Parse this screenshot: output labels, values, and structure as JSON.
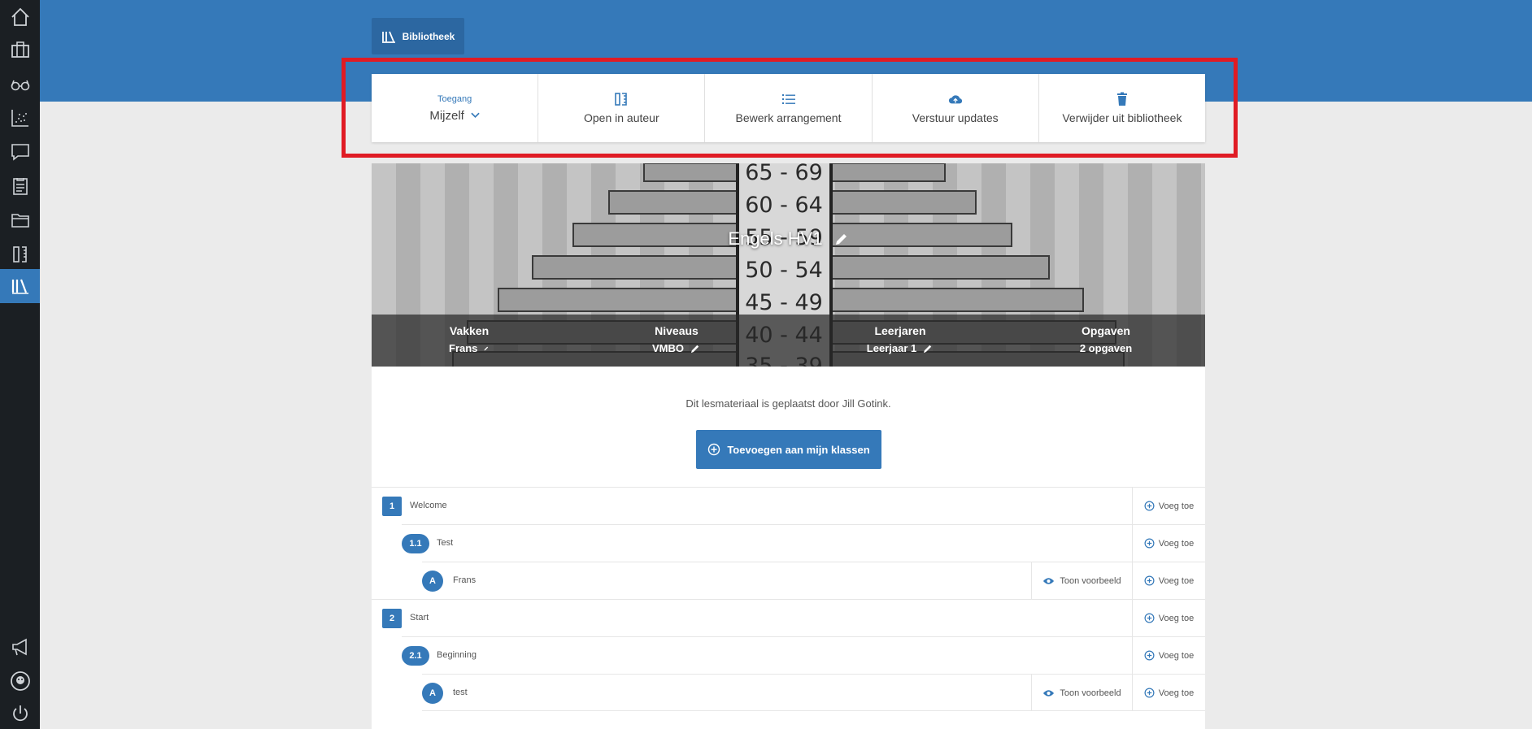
{
  "sidebar": {
    "items": [
      {
        "icon": "home-icon"
      },
      {
        "icon": "briefcase-icon"
      },
      {
        "icon": "glasses-icon"
      },
      {
        "icon": "chart-icon"
      },
      {
        "icon": "chat-icon"
      },
      {
        "icon": "clipboard-icon"
      },
      {
        "icon": "folder-icon"
      },
      {
        "icon": "author-icon"
      },
      {
        "icon": "library-icon",
        "active": true
      }
    ],
    "bottom": [
      {
        "icon": "megaphone-icon"
      },
      {
        "icon": "avatar-icon"
      },
      {
        "icon": "power-icon"
      }
    ]
  },
  "header": {
    "tab_label": "Bibliotheek"
  },
  "actions": {
    "access_label": "Toegang",
    "access_value": "Mijzelf",
    "open_author": "Open in auteur",
    "edit_arrangement": "Bewerk arrangement",
    "send_updates": "Verstuur updates",
    "remove_library": "Verwijder uit bibliotheek"
  },
  "hero": {
    "title": "Engels HV1",
    "meta": [
      {
        "head": "Vakken",
        "value": "Frans",
        "editable": true
      },
      {
        "head": "Niveaus",
        "value": "VMBO",
        "editable": true
      },
      {
        "head": "Leerjaren",
        "value": "Leerjaar 1",
        "editable": true
      },
      {
        "head": "Opgaven",
        "value": "2 opgaven",
        "editable": false
      }
    ],
    "image_labels": [
      "65 - 69",
      "60 - 64",
      "55 - 59",
      "50 - 54",
      "45 - 49",
      "40 - 44",
      "35 - 39"
    ]
  },
  "content": {
    "placed_by": "Dit lesmateriaal is geplaatst door Jill Gotink.",
    "add_button": "Toevoegen aan mijn klassen",
    "voeg_toe": "Voeg toe",
    "preview": "Toon voorbeeld",
    "rows": [
      {
        "badge": "1",
        "label": "Welcome",
        "level": 0
      },
      {
        "badge": "1.1",
        "label": "Test",
        "level": 1
      },
      {
        "badge": "A",
        "label": "Frans",
        "level": 2,
        "preview": true
      },
      {
        "badge": "2",
        "label": "Start",
        "level": 0
      },
      {
        "badge": "2.1",
        "label": "Beginning",
        "level": 1
      },
      {
        "badge": "A",
        "label": "test",
        "level": 2,
        "preview": true
      }
    ]
  },
  "colors": {
    "primary": "#3579b9",
    "sidebar": "#1b1f23",
    "highlight": "#e01b24"
  }
}
